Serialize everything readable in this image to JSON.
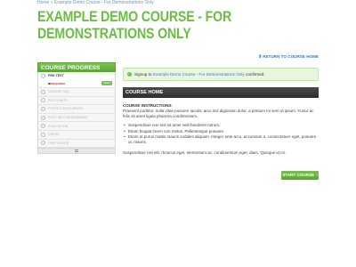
{
  "breadcrumb": {
    "home": "Home",
    "separator": "»",
    "current": "Example Demo Course - For Demonstrations Only"
  },
  "page_title": "EXAMPLE DEMO COURSE - FOR DEMONSTRATIONS ONLY",
  "return_link": "RETURN TO COURSE HOME",
  "sidebar": {
    "header": "COURSE PROGRESS",
    "active_lesson": {
      "label": "PRE-TEST",
      "required": "REQUIRED",
      "start": "Start"
    },
    "lessons": [
      {
        "label": "COURSE FAQ"
      },
      {
        "label": "POSTCASTS"
      },
      {
        "label": "POSTS & DISCUSSION"
      },
      {
        "label": "POST SELF-ASSESSMENT"
      },
      {
        "label": "EVALUATION"
      },
      {
        "label": "CREDIT"
      },
      {
        "label": "CERTIFICATE"
      }
    ]
  },
  "alert": {
    "prefix": "Signup to",
    "course": "Example Demo Course - For Demonstrations Only",
    "suffix": "confirmed."
  },
  "course_home": {
    "bar_title": "COURSE HOME",
    "instructions_title": "COURSE INSTRUCTIONS:",
    "intro": "Praesent porttitor, nulla vitae posuere iaculis, arcu nisl dignissim dolor, a pretium mi sem ut ipsum. Fusce ac felis sit amet ligula pharetra condimentum.",
    "bullets": [
      "Suspendisse non nisl sit amet velit hendrerit rutrum.",
      "Etiam feugiat lorem non metus. Pellentesque posuere.",
      "Etiam ut purus mattis mauris sodales aliquam. Integer ante arcu, accumsan a, consectetuer eget, posuere ut, mauris."
    ],
    "outro": "Suspendisse nisl elit, rhoncus eget, elementum ac, condimentum eget, diam. Quisque id mi."
  },
  "start_course": "START COURSE",
  "colors": {
    "brand_green": "#6cbd45",
    "link_blue": "#3a7bbf",
    "bar_dark": "#333333"
  }
}
